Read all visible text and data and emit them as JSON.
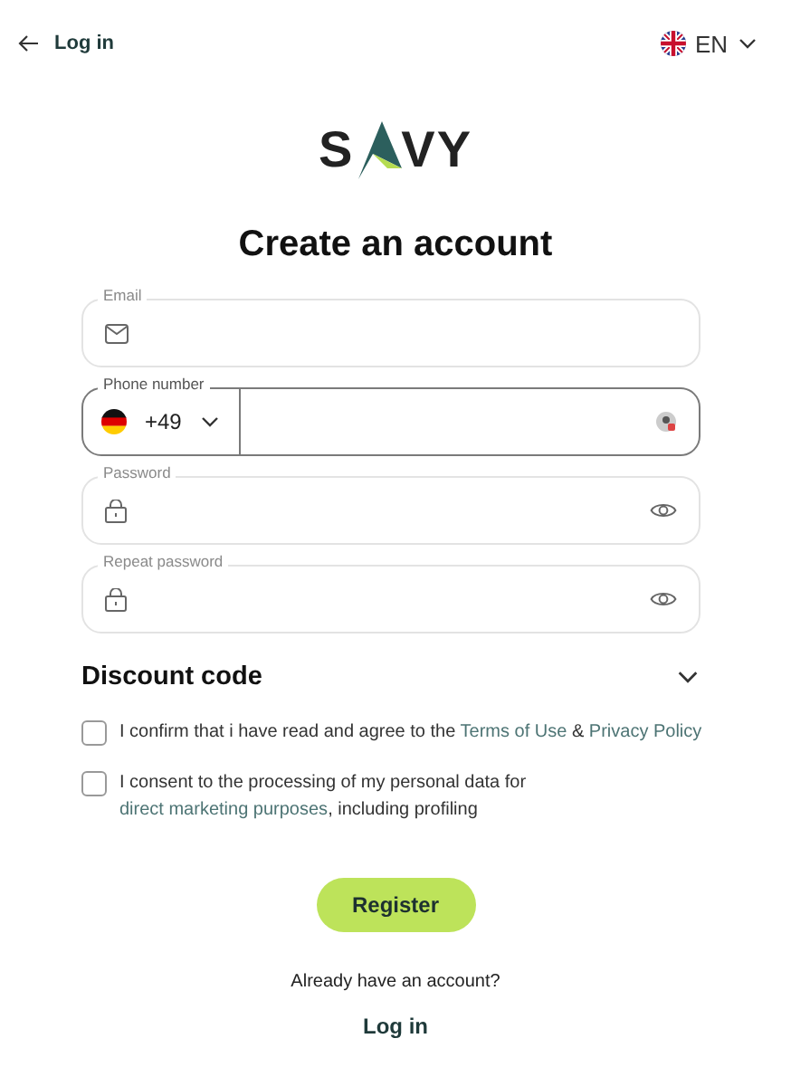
{
  "header": {
    "back_link": "Log in",
    "language": "EN"
  },
  "logo": {
    "left": "S",
    "right": "VY"
  },
  "title": "Create an account",
  "fields": [
    {
      "kind": "email",
      "label": "Email",
      "focused": false
    },
    {
      "kind": "phone",
      "label": "Phone number",
      "focused": true,
      "country_code": "+49"
    },
    {
      "kind": "password",
      "label": "Password",
      "focused": false
    },
    {
      "kind": "password",
      "label": "Repeat password",
      "focused": false
    }
  ],
  "discount": {
    "label": "Discount code",
    "expanded": false
  },
  "consents": [
    {
      "checked": false,
      "parts": [
        {
          "text": "I confirm that i have read and agree to the ",
          "link": false
        },
        {
          "text": "Terms of Use",
          "link": true
        },
        {
          "text": " & ",
          "link": false
        },
        {
          "text": "Privacy Policy",
          "link": true
        }
      ]
    },
    {
      "checked": false,
      "parts": [
        {
          "text": "I consent to the processing of my personal data for ",
          "link": false
        },
        {
          "text": "direct marketing purposes",
          "link": true
        },
        {
          "text": ", including profiling",
          "link": false
        }
      ]
    }
  ],
  "register": "Register",
  "footer": {
    "question": "Already have an account?",
    "login": "Log in"
  }
}
